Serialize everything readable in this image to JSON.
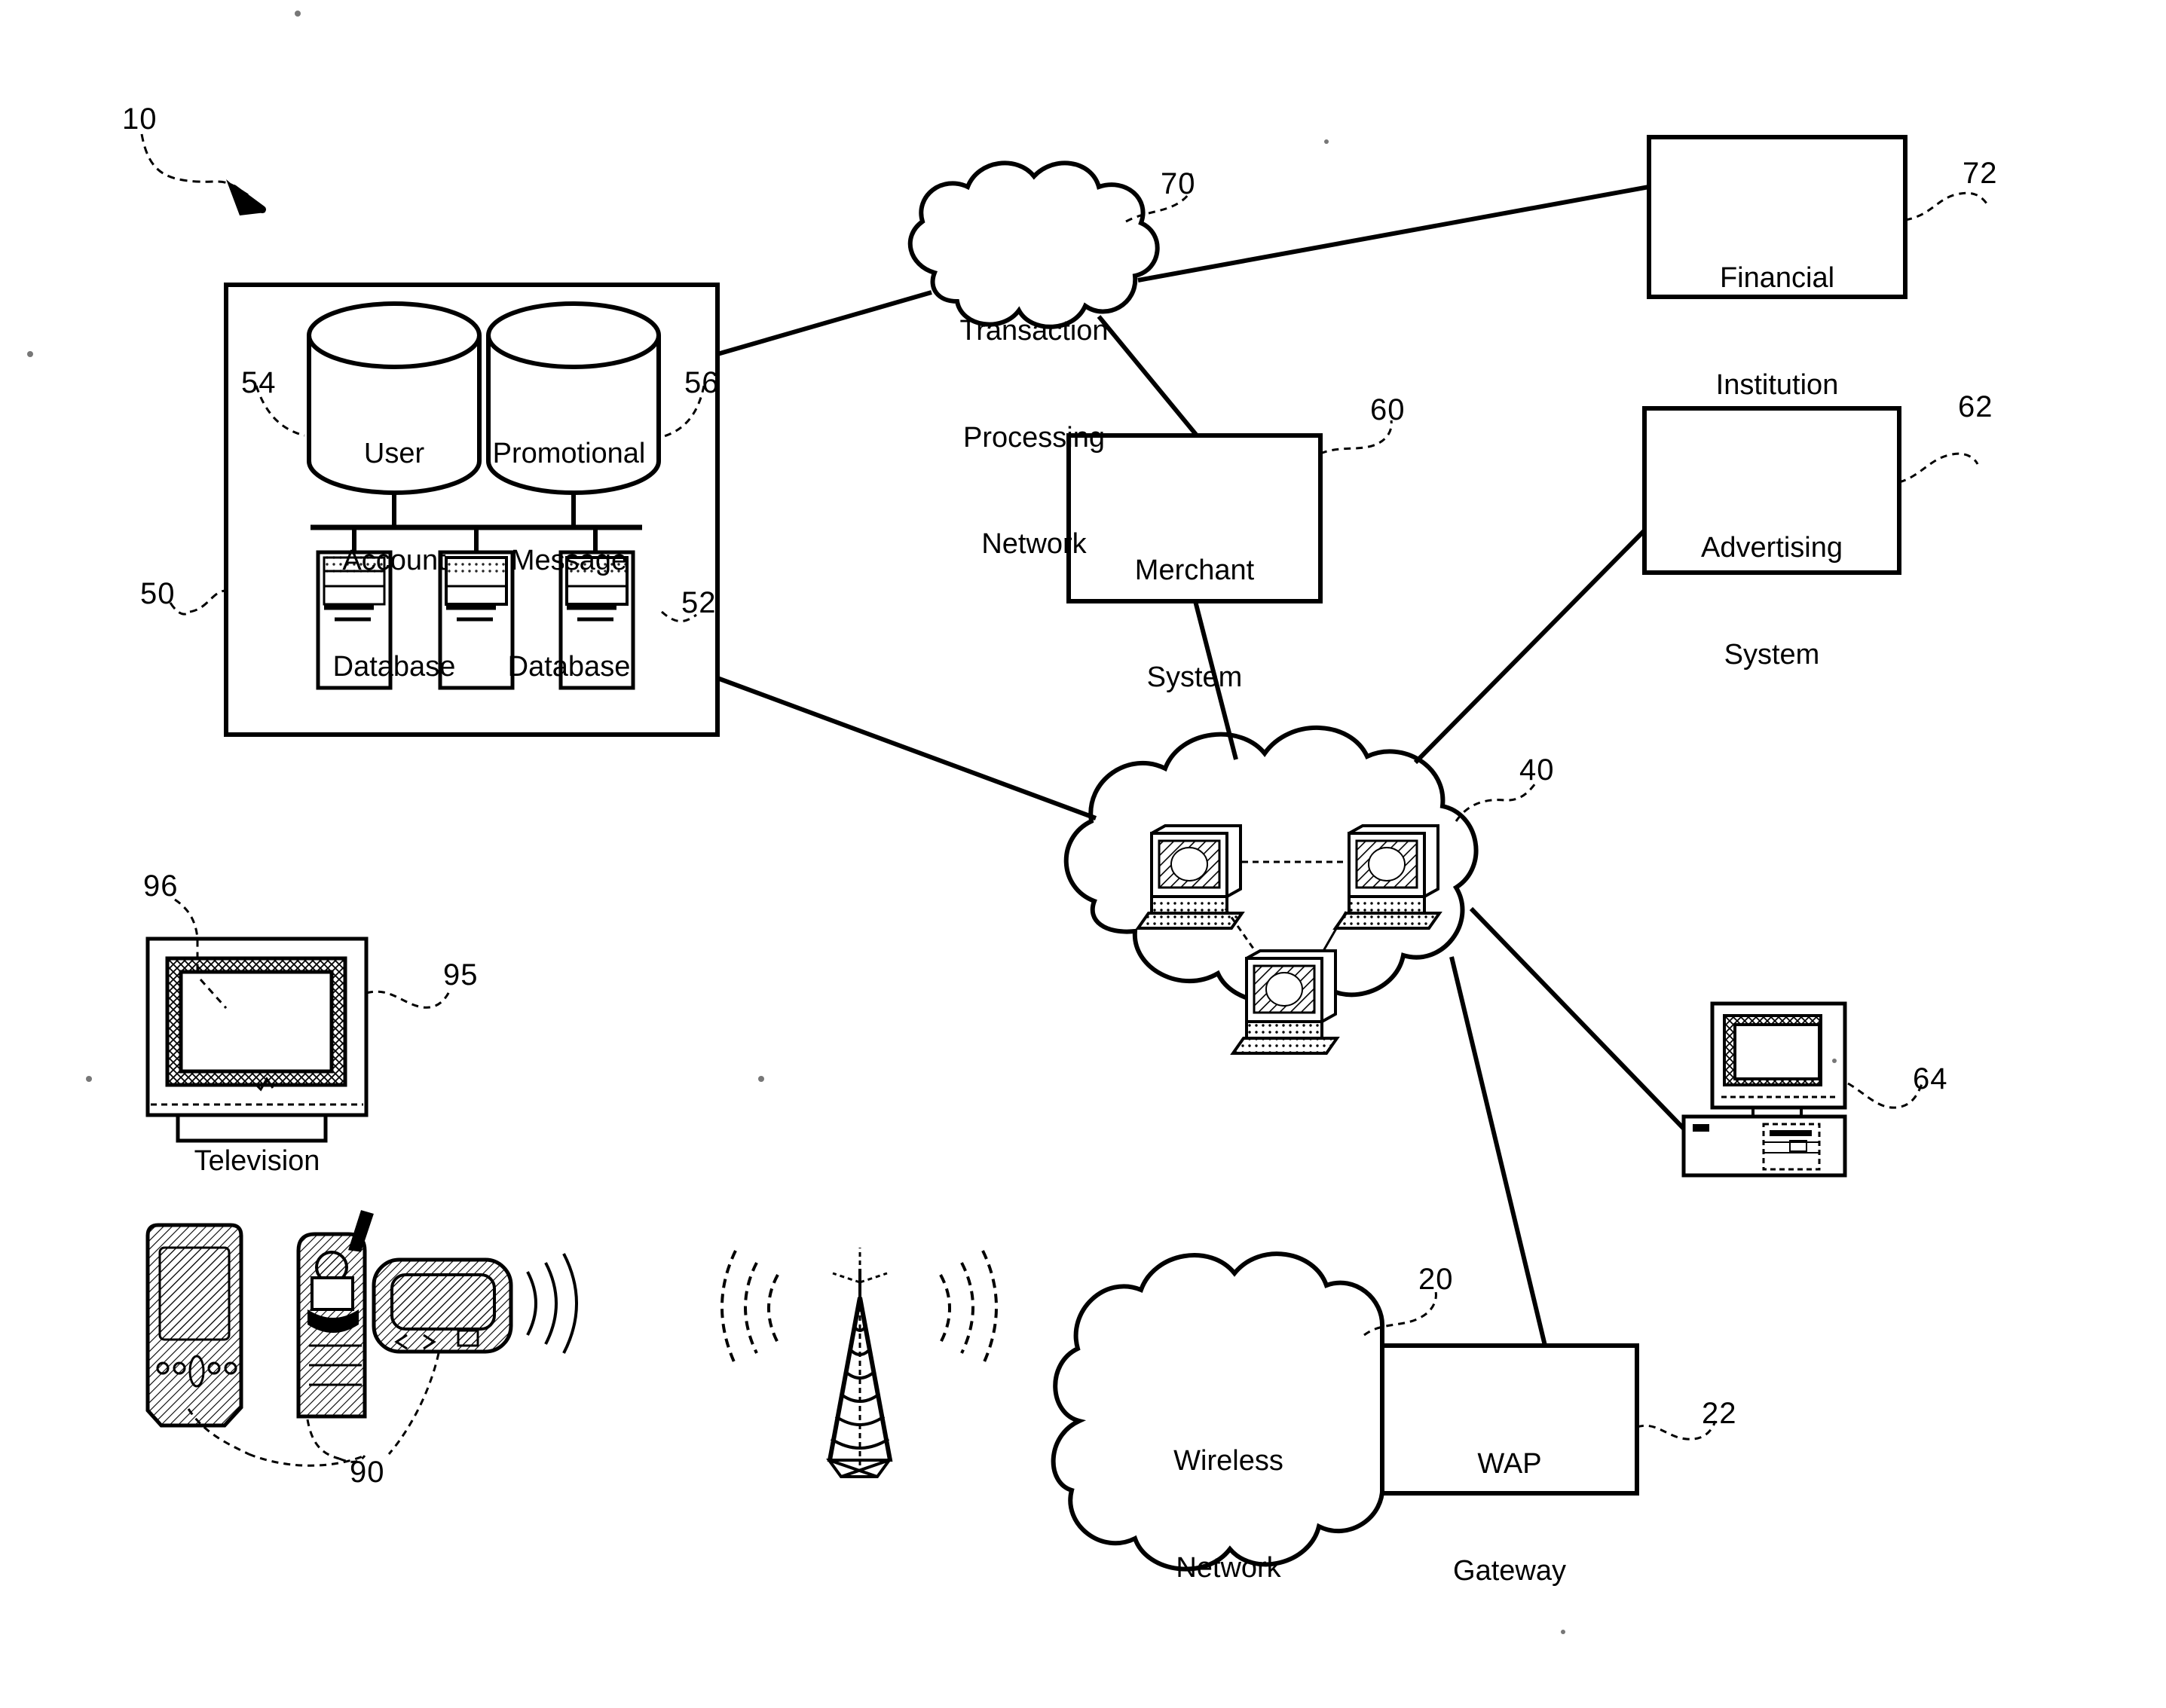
{
  "figure": {
    "reference": "10",
    "type": "patent-system-diagram"
  },
  "nodes": {
    "system_box": {
      "ref": "50",
      "databases": [
        {
          "ref": "54",
          "label": "User\nAccount\nDatabase",
          "name": "user-account-database"
        },
        {
          "ref": "56",
          "label": "Promotional\nMessage\nDatabase",
          "name": "promotional-message-database"
        }
      ],
      "servers": {
        "ref": "52",
        "count": 3,
        "name": "server-group"
      }
    },
    "transaction_processing_network": {
      "ref": "70",
      "label": "Transaction\nProcessing\nNetwork"
    },
    "financial_institution": {
      "ref": "72",
      "label": "Financial\nInstitution"
    },
    "merchant_system": {
      "ref": "60",
      "label": "Merchant\nSystem"
    },
    "advertising_system": {
      "ref": "62",
      "label": "Advertising\nSystem"
    },
    "internet_cloud": {
      "ref": "40",
      "label": ""
    },
    "personal_computer": {
      "ref": "64",
      "label": ""
    },
    "television": {
      "ref": "95",
      "screen_ref": "96",
      "label": "Television"
    },
    "mobile_devices": {
      "ref": "90",
      "items": [
        "pda",
        "cell-phone",
        "pager"
      ]
    },
    "cell_tower": {
      "label": ""
    },
    "wireless_network": {
      "ref": "20",
      "label": "Wireless\nNetwork"
    },
    "wap_gateway": {
      "ref": "22",
      "label": "WAP\nGateway"
    }
  },
  "refs": {
    "r10": "10",
    "r20": "20",
    "r22": "22",
    "r40": "40",
    "r50": "50",
    "r52": "52",
    "r54": "54",
    "r56": "56",
    "r60": "60",
    "r62": "62",
    "r64": "64",
    "r70": "70",
    "r72": "72",
    "r90": "90",
    "r95": "95",
    "r96": "96"
  },
  "text": {
    "transaction_processing_network_l1": "Transaction",
    "transaction_processing_network_l2": "Processing",
    "transaction_processing_network_l3": "Network",
    "financial_institution_l1": "Financial",
    "financial_institution_l2": "Institution",
    "merchant_system_l1": "Merchant",
    "merchant_system_l2": "System",
    "advertising_system_l1": "Advertising",
    "advertising_system_l2": "System",
    "wireless_network_l1": "Wireless",
    "wireless_network_l2": "Network",
    "wap_gateway_l1": "WAP",
    "wap_gateway_l2": "Gateway",
    "user_account_db_l1": "User",
    "user_account_db_l2": "Account",
    "user_account_db_l3": "Database",
    "promo_msg_db_l1": "Promotional",
    "promo_msg_db_l2": "Message",
    "promo_msg_db_l3": "Database",
    "television_caption": "Television"
  },
  "colors": {
    "ink": "#000000",
    "paper": "#ffffff",
    "hatch": "#000000"
  }
}
